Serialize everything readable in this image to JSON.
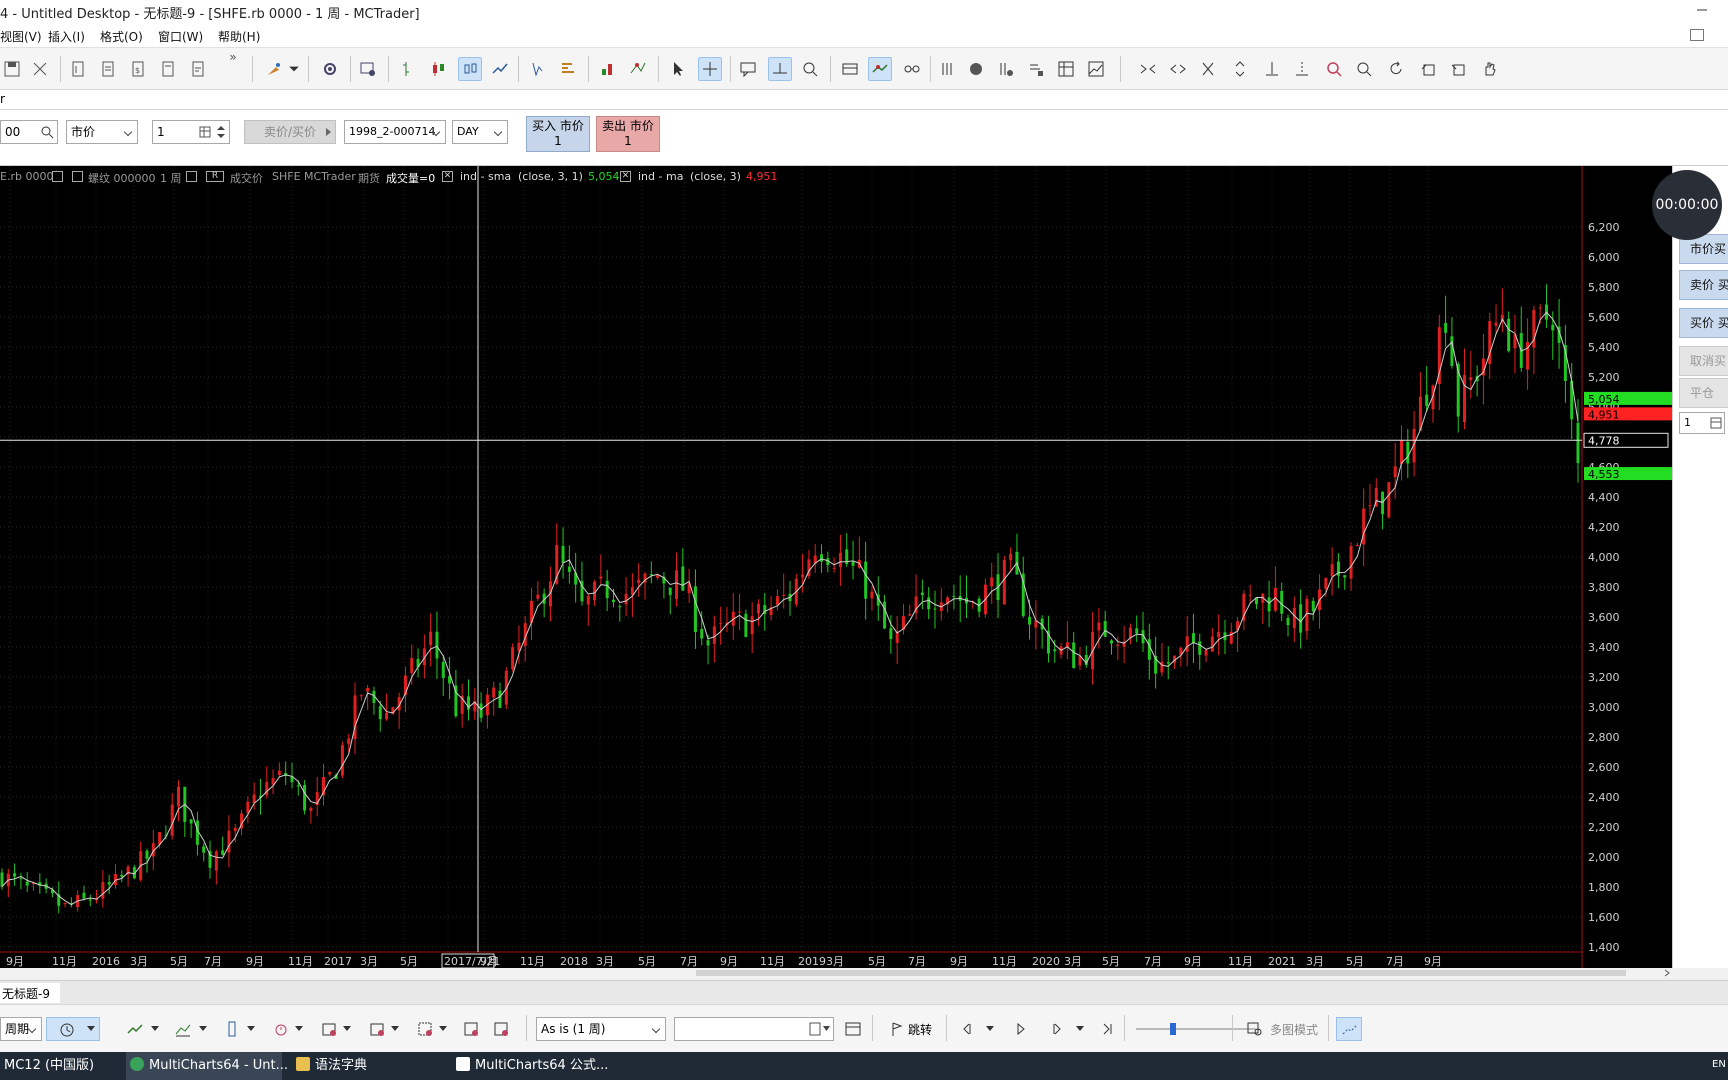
{
  "window": {
    "title": "4 - Untitled Desktop - 无标题-9 - [SHFE.rb 0000 - 1 周 - MCTrader]"
  },
  "menu": [
    "视图(V)",
    "插入(I)",
    "格式(O)",
    "窗口(W)",
    "帮助(H)"
  ],
  "tabstrip": {
    "label": "r"
  },
  "orderbar": {
    "symbol_value": "00",
    "order_type": "市价",
    "quantity": "1",
    "bid_ask_button": "卖价/买价",
    "account": "1998_2-000714",
    "tif": "DAY",
    "buy_button_line1": "买入 市价",
    "buy_button_line2": "1",
    "sell_button_line1": "卖出 市价",
    "sell_button_line2": "1",
    "buy_color": "#c6d5ea",
    "sell_color": "#e8a8a8"
  },
  "chart_status": {
    "symbol": "E.rb 0000",
    "instrument": "螺纹 000000",
    "period": "1 周",
    "price_type": "成交价",
    "exchange": "SHFE",
    "broker": "MCTrader",
    "category": "期货",
    "volume": "成交量=0",
    "ind1_name": "ind - sma",
    "ind1_params": "(close,  3,  1)",
    "ind1_value": "5,054",
    "ind2_name": "ind - ma",
    "ind2_params": "(close,  3)",
    "ind2_value": "4,951"
  },
  "timer": "00:00:00",
  "right_panel": {
    "buttons": [
      "市价买",
      "卖价 买",
      "买价 买",
      "取消买",
      "平仓"
    ],
    "quantity": "1"
  },
  "chart_data": {
    "type": "candlestick",
    "title": "",
    "ylim": [
      1400,
      6400
    ],
    "yticks": [
      "1,400",
      "1,600",
      "1,800",
      "2,000",
      "2,200",
      "2,400",
      "2,600",
      "2,800",
      "3,000",
      "3,200",
      "3,400",
      "3,600",
      "3,800",
      "4,000",
      "4,200",
      "4,400",
      "4,600",
      "4,800",
      "5,000",
      "5,200",
      "5,400",
      "5,600",
      "5,800",
      "6,000",
      "6,200"
    ],
    "xticks": [
      "9月",
      "11月",
      "2016",
      "3月",
      "5月",
      "7月",
      "9月",
      "11月",
      "2017",
      "3月",
      "5月",
      "2017/7/21",
      "9月",
      "11月",
      "2018",
      "3月",
      "5月",
      "7月",
      "9月",
      "11月",
      "2019",
      "3月",
      "5月",
      "7月",
      "9月",
      "11月",
      "2020",
      "3月",
      "5月",
      "7月",
      "9月",
      "11月",
      "2021",
      "3月",
      "5月",
      "7月",
      "9月"
    ],
    "crosshair": {
      "price": "4,778",
      "date": "2017/7/21"
    },
    "price_markers": [
      {
        "label": "5,054",
        "value": 5054,
        "color": "#22dd22"
      },
      {
        "label": "4,951",
        "value": 4951,
        "color": "#ff2222"
      },
      {
        "label": "4,553",
        "value": 4553,
        "color": "#22dd22"
      }
    ],
    "up_color": "#e02020",
    "down_color": "#22c522",
    "ma_color": "#cfcfcf",
    "keypoints": [
      [
        0,
        1880
      ],
      [
        4,
        1780
      ],
      [
        8,
        1710
      ],
      [
        10,
        1660
      ],
      [
        13,
        1700
      ],
      [
        18,
        1820
      ],
      [
        24,
        2030
      ],
      [
        28,
        2400
      ],
      [
        30,
        2200
      ],
      [
        33,
        2000
      ],
      [
        37,
        2150
      ],
      [
        41,
        2450
      ],
      [
        45,
        2550
      ],
      [
        49,
        2300
      ],
      [
        53,
        2600
      ],
      [
        57,
        3100
      ],
      [
        61,
        2950
      ],
      [
        64,
        3150
      ],
      [
        68,
        3450
      ],
      [
        72,
        3000
      ],
      [
        76,
        2950
      ],
      [
        79,
        3100
      ],
      [
        84,
        3600
      ],
      [
        88,
        4000
      ],
      [
        92,
        3650
      ],
      [
        96,
        3800
      ],
      [
        100,
        3750
      ],
      [
        104,
        3880
      ],
      [
        108,
        3800
      ],
      [
        112,
        3420
      ],
      [
        116,
        3550
      ],
      [
        120,
        3600
      ],
      [
        125,
        3750
      ],
      [
        129,
        4100
      ],
      [
        133,
        4000
      ],
      [
        137,
        3820
      ],
      [
        141,
        3400
      ],
      [
        145,
        3650
      ],
      [
        149,
        3800
      ],
      [
        153,
        3700
      ],
      [
        157,
        3800
      ],
      [
        160,
        3900
      ],
      [
        163,
        3600
      ],
      [
        167,
        3380
      ],
      [
        171,
        3330
      ],
      [
        175,
        3520
      ],
      [
        180,
        3480
      ],
      [
        183,
        3280
      ],
      [
        186,
        3300
      ],
      [
        190,
        3450
      ],
      [
        194,
        3550
      ],
      [
        198,
        3700
      ],
      [
        202,
        3750
      ],
      [
        205,
        3550
      ],
      [
        208,
        3650
      ],
      [
        212,
        3900
      ],
      [
        216,
        4250
      ],
      [
        220,
        4450
      ],
      [
        224,
        4850
      ],
      [
        227,
        5300
      ],
      [
        229,
        5650
      ],
      [
        231,
        5000
      ],
      [
        234,
        5250
      ],
      [
        238,
        5650
      ],
      [
        240,
        5350
      ],
      [
        243,
        5500
      ],
      [
        246,
        5650
      ],
      [
        248,
        5100
      ],
      [
        250,
        4600
      ]
    ]
  },
  "bottombar": {
    "period_label": "周期",
    "scale_mode": "As is (1 周)",
    "goto_label": "跳转",
    "multichart_label": "多图模式"
  },
  "sheet_tab": "无标题-9",
  "taskbar": [
    {
      "label": "MC12 (中国版)"
    },
    {
      "label": "MultiCharts64 - Unt..."
    },
    {
      "label": "语法字典"
    },
    {
      "label": "MultiCharts64 公式..."
    }
  ],
  "tray": "EN"
}
